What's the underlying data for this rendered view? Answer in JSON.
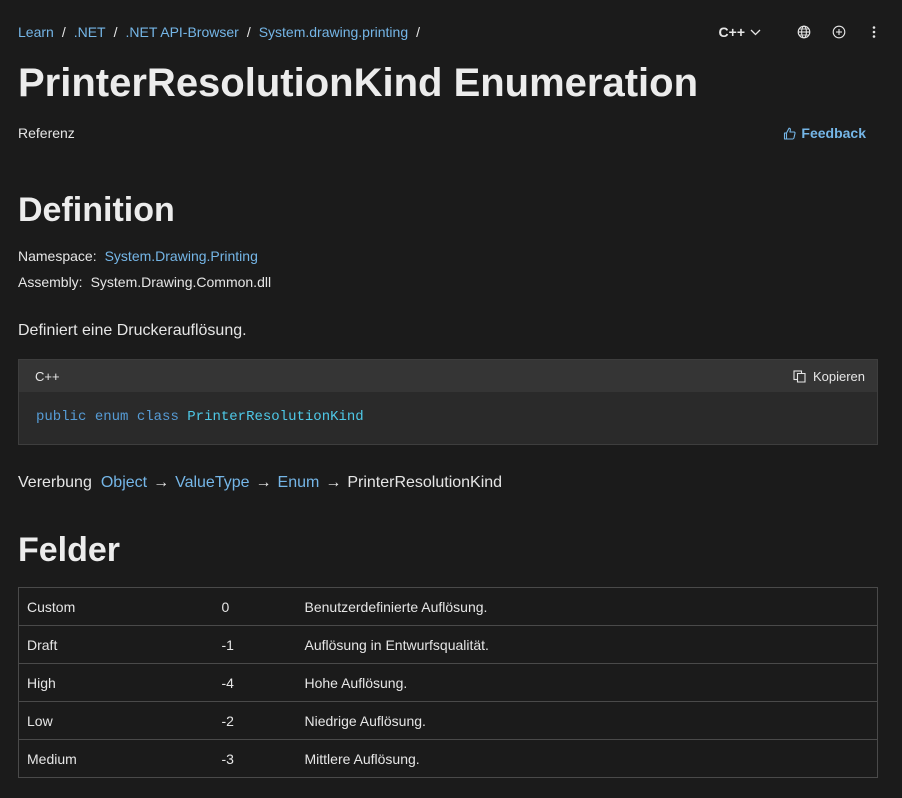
{
  "breadcrumb": [
    {
      "label": "Learn"
    },
    {
      "label": ".NET"
    },
    {
      "label": ".NET API-Browser"
    },
    {
      "label": "System.drawing.printing"
    }
  ],
  "breadcrumb_separator": "/",
  "header": {
    "language_label": "C++",
    "icons": [
      "globe-icon",
      "add-circle-icon",
      "more-vertical-icon"
    ]
  },
  "page": {
    "title": "PrinterResolutionKind Enumeration",
    "reference_label": "Referenz",
    "feedback_label": "Feedback"
  },
  "definition": {
    "heading": "Definition",
    "namespace_label": "Namespace:",
    "namespace_value": "System.Drawing.Printing",
    "assembly_label": "Assembly:",
    "assembly_value": "System.Drawing.Common.dll",
    "description": "Definiert eine Druckerauflösung."
  },
  "code": {
    "language": "C++",
    "copy_label": "Kopieren",
    "tokens": {
      "kw1": "public",
      "kw2": "enum",
      "kw3": "class",
      "type": "PrinterResolutionKind"
    }
  },
  "inheritance": {
    "label": "Vererbung",
    "arrow": "→",
    "chain": [
      "Object",
      "ValueType",
      "Enum"
    ],
    "current": "PrinterResolutionKind"
  },
  "fields": {
    "heading": "Felder",
    "rows": [
      {
        "name": "Custom",
        "value": "0",
        "description": "Benutzerdefinierte Auflösung."
      },
      {
        "name": "Draft",
        "value": "-1",
        "description": "Auflösung in Entwurfsqualität."
      },
      {
        "name": "High",
        "value": "-4",
        "description": "Hohe Auflösung."
      },
      {
        "name": "Low",
        "value": "-2",
        "description": "Niedrige Auflösung."
      },
      {
        "name": "Medium",
        "value": "-3",
        "description": "Mittlere Auflösung."
      }
    ]
  },
  "colors": {
    "background": "#1b1b1b",
    "link": "#75b6e7",
    "code_keyword": "#569cd6",
    "code_type": "#4ec9e8"
  }
}
